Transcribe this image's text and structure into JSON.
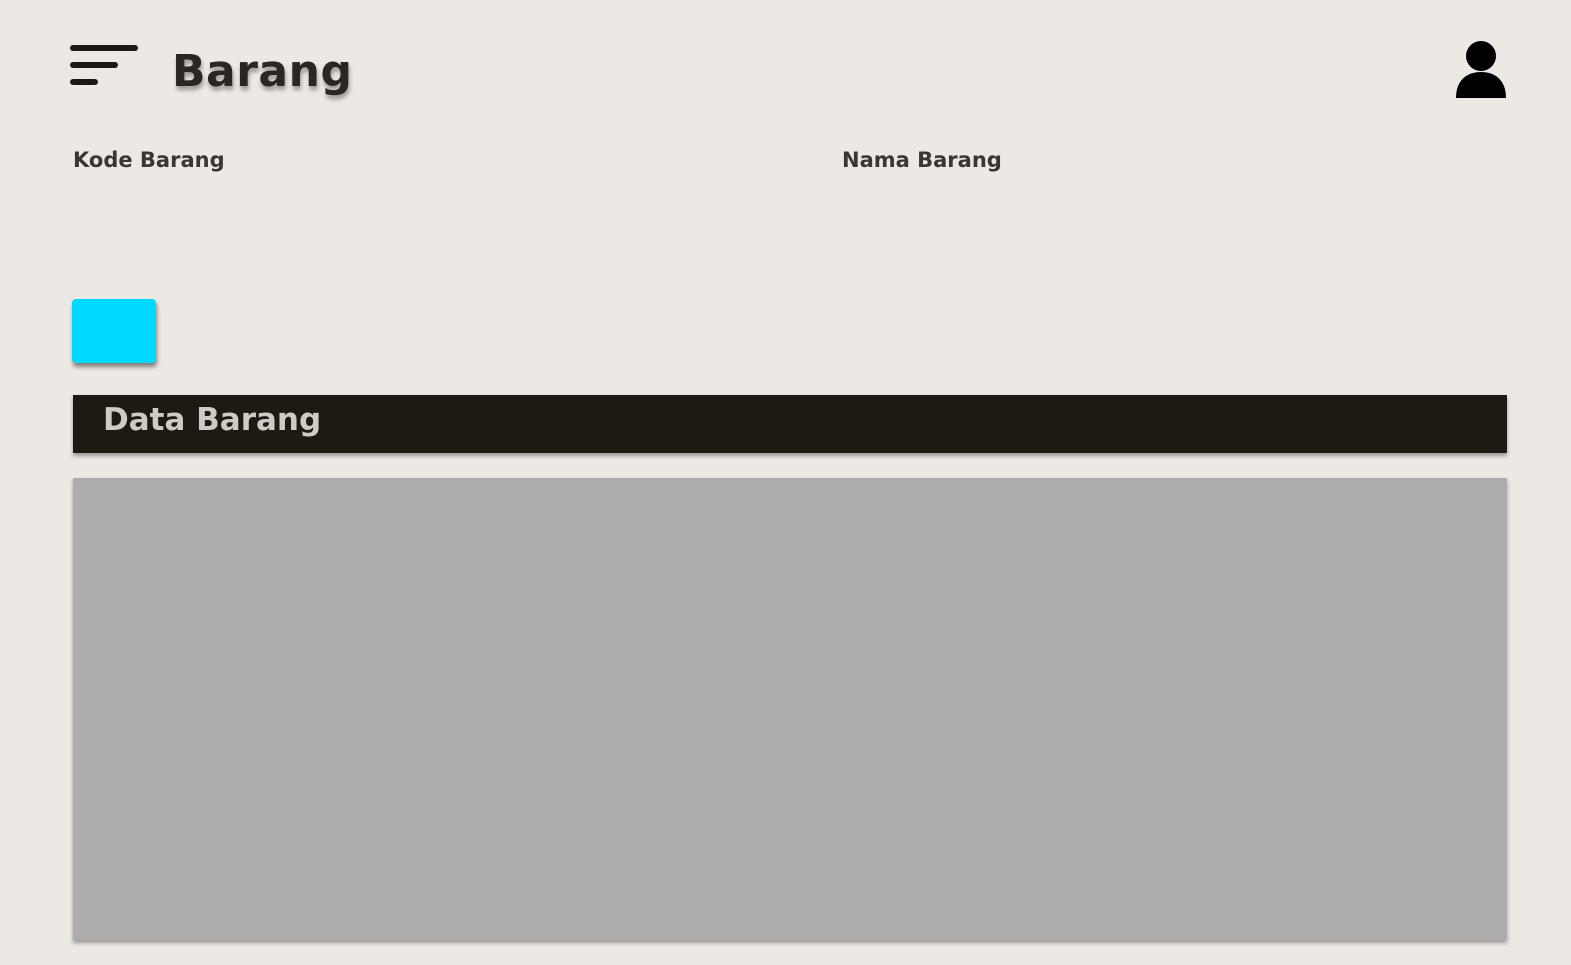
{
  "header": {
    "title": "Barang",
    "menu_icon": "hamburger-menu-icon",
    "user_icon": "user-profile-icon"
  },
  "form": {
    "kode_label": "Kode Barang",
    "kode_value": "",
    "nama_label": "Nama Barang",
    "nama_value": "",
    "action_button_label": ""
  },
  "table": {
    "section_title": "Data Barang",
    "rows": []
  },
  "colors": {
    "background": "#ece8e4",
    "accent_button": "#00d9ff",
    "section_header_bg": "#1d1a14",
    "section_header_text": "#cfcac4",
    "table_area_bg": "#acacac",
    "icon_color": "#1d1a16"
  }
}
